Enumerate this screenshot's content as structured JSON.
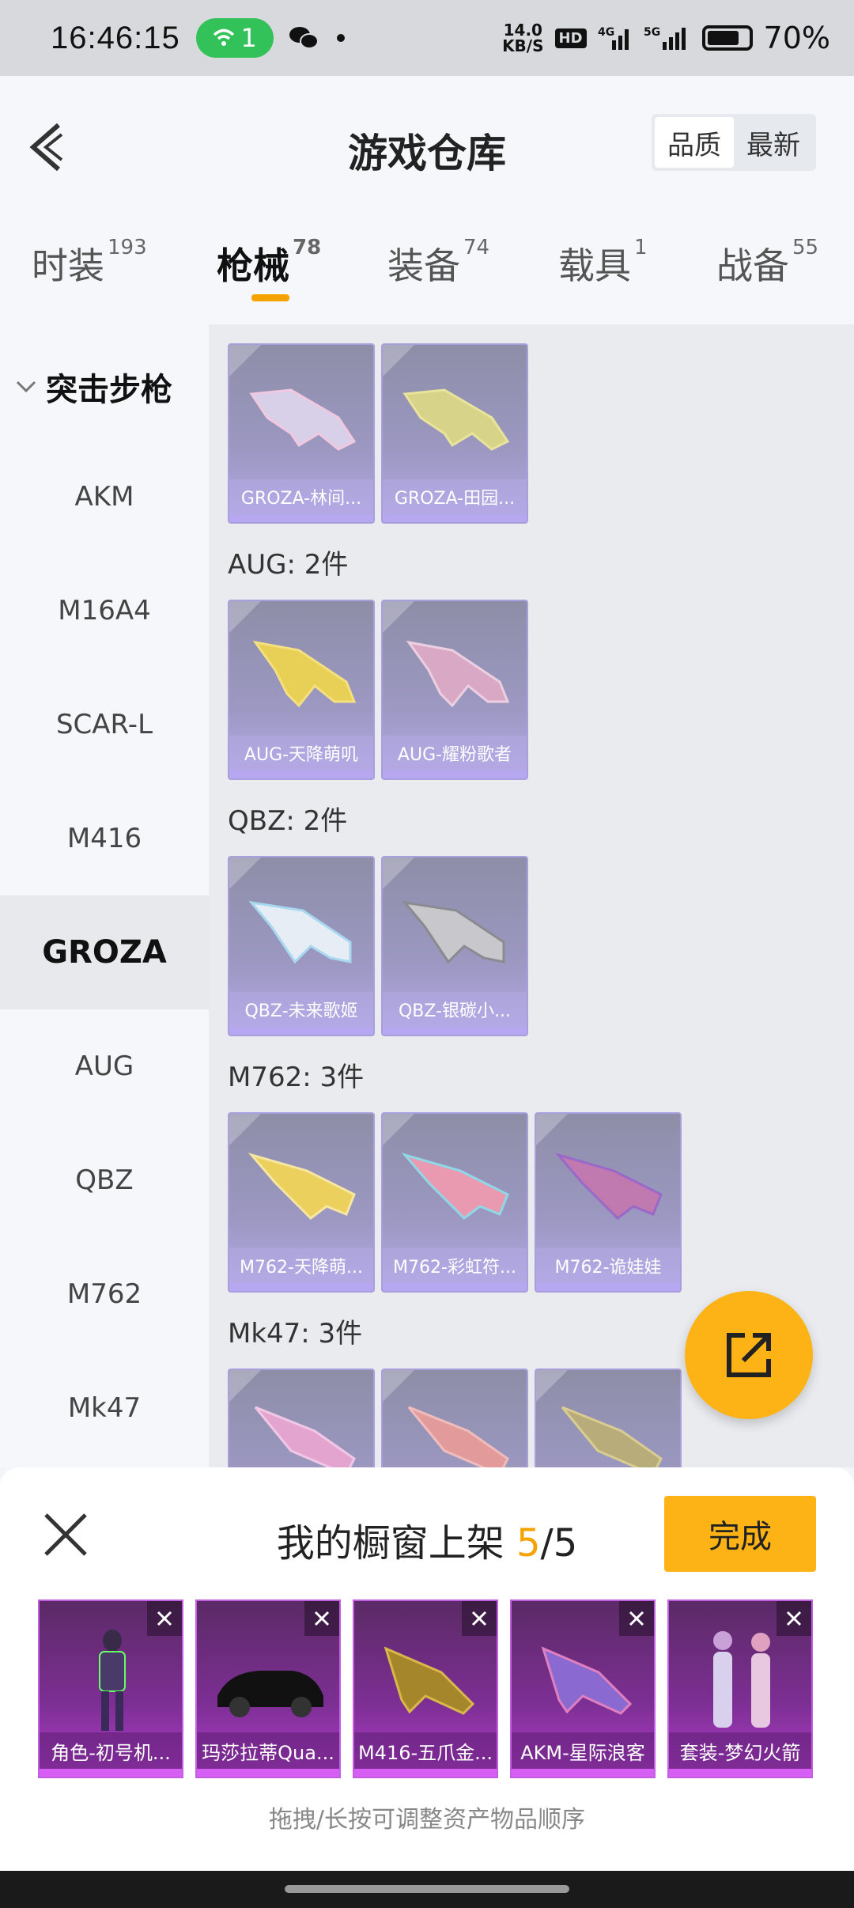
{
  "status": {
    "time": "16:46:15",
    "wifi_count": "1",
    "speed": "14.0",
    "speed_unit": "KB/S",
    "battery": "70%"
  },
  "header": {
    "title": "游戏仓库",
    "sort": [
      "品质",
      "最新"
    ]
  },
  "tabs": [
    {
      "label": "时装",
      "count": "193"
    },
    {
      "label": "枪械",
      "count": "78"
    },
    {
      "label": "装备",
      "count": "74"
    },
    {
      "label": "载具",
      "count": "1"
    },
    {
      "label": "战备",
      "count": "55"
    }
  ],
  "nav": {
    "category": "突击步枪",
    "items": [
      "AKM",
      "M16A4",
      "SCAR-L",
      "M416",
      "GROZA",
      "AUG",
      "QBZ",
      "M762",
      "Mk47"
    ]
  },
  "groups": [
    {
      "title": "",
      "items": [
        "GROZA-林间...",
        "GROZA-田园..."
      ]
    },
    {
      "title": "AUG: 2件",
      "items": [
        "AUG-天降萌叽",
        "AUG-耀粉歌者"
      ]
    },
    {
      "title": "QBZ: 2件",
      "items": [
        "QBZ-未来歌姬",
        "QBZ-银碳小..."
      ]
    },
    {
      "title": "M762: 3件",
      "items": [
        "M762-天降萌...",
        "M762-彩虹符...",
        "M762-诡娃娃"
      ]
    },
    {
      "title": "Mk47: 3件",
      "items": [
        "",
        "",
        ""
      ]
    }
  ],
  "sheet": {
    "title_prefix": "我的橱窗上架 ",
    "count": "5",
    "total": "/5",
    "done": "完成",
    "slots": [
      "角色-初号机...",
      "玛莎拉蒂Qua...",
      "M416-五爪金...",
      "AKM-星际浪客",
      "套装-梦幻火箭"
    ],
    "hint": "拖拽/长按可调整资产物品顺序"
  },
  "colors": {
    "accent": "#fdb315",
    "tab_underline": "#f5a300"
  }
}
